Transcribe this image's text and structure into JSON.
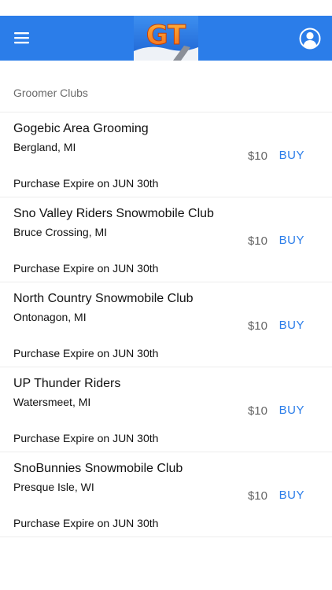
{
  "header": {
    "logo_text": "GT",
    "menu_icon": "hamburger-menu-icon",
    "profile_icon": "user-profile-icon",
    "brand_color": "#2b7de9"
  },
  "section": {
    "title": "Groomer Clubs"
  },
  "clubs": [
    {
      "name": "Gogebic Area Grooming",
      "location": "Bergland, MI",
      "price": "$10",
      "buy_label": "BUY",
      "expire": "Purchase Expire on JUN 30th"
    },
    {
      "name": "Sno Valley Riders Snowmobile Club",
      "location": "Bruce Crossing, MI",
      "price": "$10",
      "buy_label": "BUY",
      "expire": "Purchase Expire on JUN 30th"
    },
    {
      "name": "North Country Snowmobile Club",
      "location": "Ontonagon, MI",
      "price": "$10",
      "buy_label": "BUY",
      "expire": "Purchase Expire on JUN 30th"
    },
    {
      "name": "UP Thunder Riders",
      "location": "Watersmeet, MI",
      "price": "$10",
      "buy_label": "BUY",
      "expire": "Purchase Expire on JUN 30th"
    },
    {
      "name": "SnoBunnies Snowmobile Club",
      "location": "Presque Isle, WI",
      "price": "$10",
      "buy_label": "BUY",
      "expire": "Purchase Expire on JUN 30th"
    }
  ]
}
